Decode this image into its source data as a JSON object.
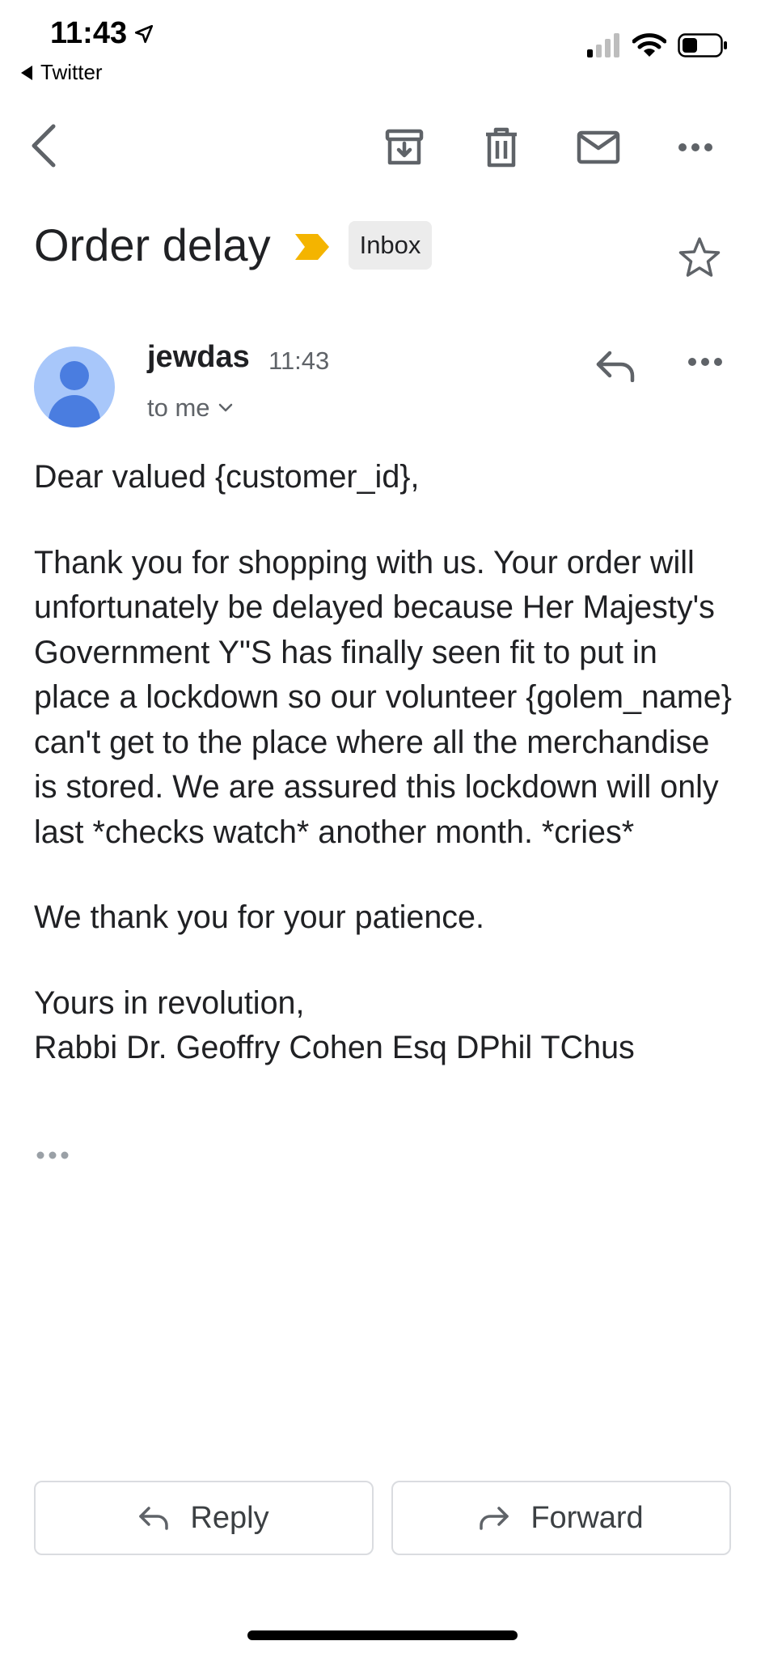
{
  "status_bar": {
    "time": "11:43",
    "location_icon": "location-arrow-icon",
    "back_app_label": "Twitter",
    "signal_icon": "cellular-signal-icon",
    "wifi_icon": "wifi-icon",
    "battery_icon": "battery-icon"
  },
  "toolbar": {
    "back_icon": "chevron-left-icon",
    "archive_icon": "archive-icon",
    "delete_icon": "trash-icon",
    "mark_unread_icon": "mail-icon",
    "more_icon": "more-horizontal-icon"
  },
  "email": {
    "subject": "Order delay",
    "label": "Inbox",
    "importance_color": "#f4b400",
    "sender": {
      "name": "jewdas",
      "time": "11:43",
      "recipient": "to me",
      "avatar_color": "#a8c7fa",
      "avatar_fg": "#4a7de0"
    },
    "body": {
      "greeting": "Dear valued {customer_id},",
      "paragraph": "Thank you for shopping with us. Your order will unfortunately be delayed because Her Majesty's Government Y\"S has finally seen fit to put in place a lockdown so our volunteer {golem_name} can't get to the place where all the merchandise is stored. We are assured this lockdown will only last *checks watch* another month. *cries*",
      "thanks": "We thank you for your patience.",
      "signoff": "Yours in revolution,",
      "signature": "Rabbi Dr. Geoffry Cohen Esq DPhil TChus"
    }
  },
  "actions": {
    "reply_label": "Reply",
    "forward_label": "Forward"
  }
}
